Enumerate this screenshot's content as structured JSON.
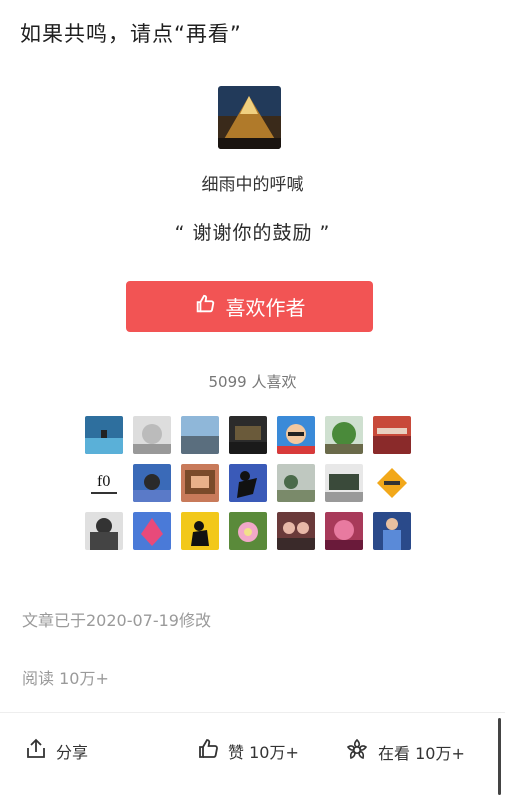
{
  "article": {
    "closing_text": "如果共鸣，请点“再看”",
    "modified_text": "文章已于2020-07-19修改",
    "read_text": "阅读 10万+"
  },
  "author": {
    "name": "细雨中的呼喊",
    "quote": "“ 谢谢你的鼓励 ”",
    "like_button_label": "喜欢作者",
    "like_count_text": "5099 人喜欢"
  },
  "colors": {
    "accent": "#f25454"
  },
  "bottom_bar": {
    "share_label": "分享",
    "like_label": "赞 10万+",
    "wow_label": "在看 10万+"
  }
}
